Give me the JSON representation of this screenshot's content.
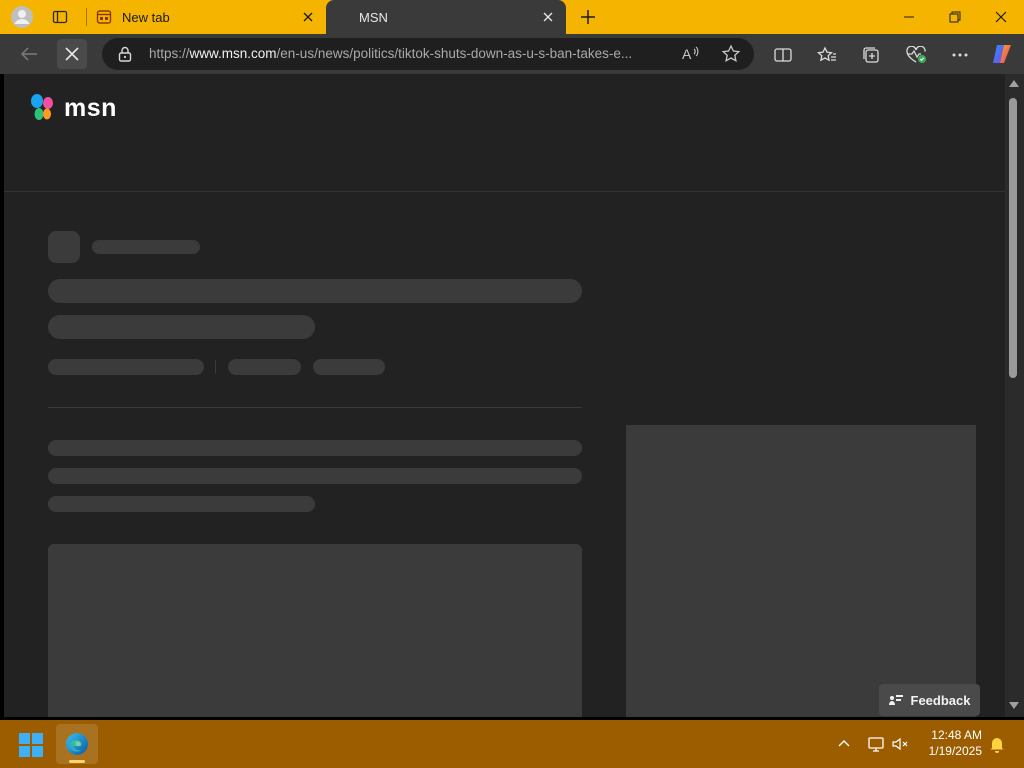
{
  "browser": {
    "tabs": [
      {
        "title": "New tab",
        "active": false
      },
      {
        "title": "MSN",
        "active": true
      }
    ],
    "address_bar": {
      "url_prefix": "https://",
      "url_host": "www.msn.com",
      "url_path": "/en-us/news/politics/tiktok-shuts-down-as-u-s-ban-takes-e..."
    },
    "icons": {
      "profile": "profile-icon",
      "tab_actions": "tab-actions-icon",
      "new_tab": "plus-icon",
      "back": "back-arrow-icon",
      "stop": "stop-loading-icon",
      "read_aloud": "read-aloud-icon",
      "favorite": "star-icon",
      "split_screen": "split-screen-icon",
      "favorites": "favorites-icon",
      "collections": "collections-icon",
      "browser_essentials": "heart-pulse-icon",
      "more": "more-icon",
      "copilot": "copilot-icon"
    }
  },
  "page": {
    "logo_text": "msn",
    "feedback_label": "Feedback",
    "state": "loading-skeleton"
  },
  "taskbar": {
    "time": "12:48 AM",
    "date": "1/19/2025",
    "accent": "#9b5d00"
  },
  "colors": {
    "titlebar": "#f5b400",
    "toolbar": "#3a3a3a",
    "page_bg": "#222222",
    "skeleton": "#3b3b3b"
  }
}
